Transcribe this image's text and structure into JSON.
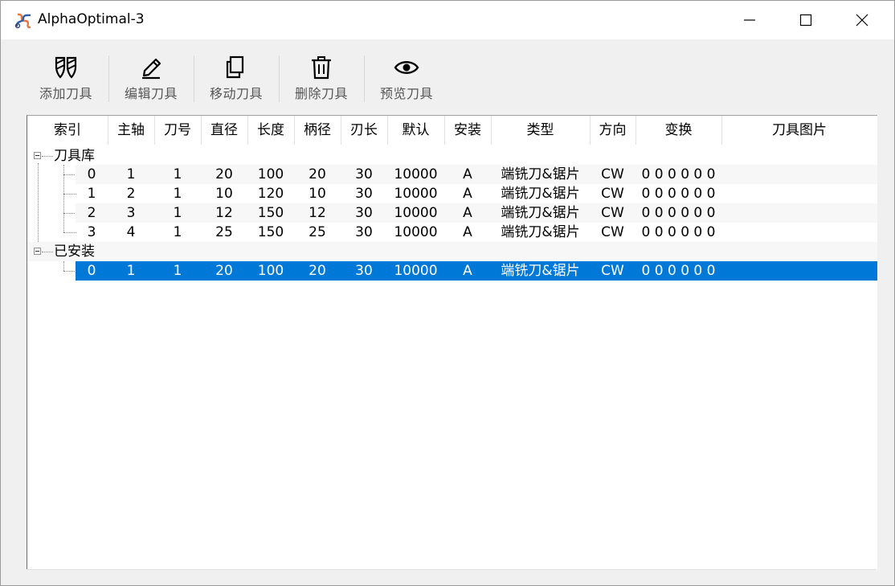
{
  "window": {
    "title": "AlphaOptimal-3",
    "controls": {
      "minimize": "minimize-icon",
      "maximize": "maximize-icon",
      "close": "close-icon"
    }
  },
  "toolbar": {
    "items": [
      {
        "label": "添加刀具",
        "icon": "end-mill-icon"
      },
      {
        "label": "编辑刀具",
        "icon": "pencil-icon"
      },
      {
        "label": "移动刀具",
        "icon": "copy-icon"
      },
      {
        "label": "删除刀具",
        "icon": "trash-icon"
      },
      {
        "label": "预览刀具",
        "icon": "eye-icon"
      }
    ]
  },
  "grid": {
    "columns": [
      "索引",
      "主轴",
      "刀号",
      "直径",
      "长度",
      "柄径",
      "刃长",
      "默认",
      "安装",
      "类型",
      "方向",
      "变换",
      "刀具图片"
    ],
    "groups": [
      {
        "label": "刀具库",
        "rows": [
          [
            "0",
            "1",
            "1",
            "20",
            "100",
            "20",
            "30",
            "10000",
            "A",
            "端铣刀&锯片",
            "CW",
            "0 0 0 0 0 0"
          ],
          [
            "1",
            "2",
            "1",
            "10",
            "120",
            "10",
            "30",
            "10000",
            "A",
            "端铣刀&锯片",
            "CW",
            "0 0 0 0 0 0"
          ],
          [
            "2",
            "3",
            "1",
            "12",
            "150",
            "12",
            "30",
            "10000",
            "A",
            "端铣刀&锯片",
            "CW",
            "0 0 0 0 0 0"
          ],
          [
            "3",
            "4",
            "1",
            "25",
            "150",
            "25",
            "30",
            "10000",
            "A",
            "端铣刀&锯片",
            "CW",
            "0 0 0 0 0 0"
          ]
        ]
      },
      {
        "label": "已安装",
        "rows": [
          [
            "0",
            "1",
            "1",
            "20",
            "100",
            "20",
            "30",
            "10000",
            "A",
            "端铣刀&锯片",
            "CW",
            "0 0 0 0 0 0"
          ]
        ],
        "selected_row": 0
      }
    ]
  },
  "colors": {
    "selection": "#0078d7",
    "alt_row": "#f7f7f7"
  }
}
